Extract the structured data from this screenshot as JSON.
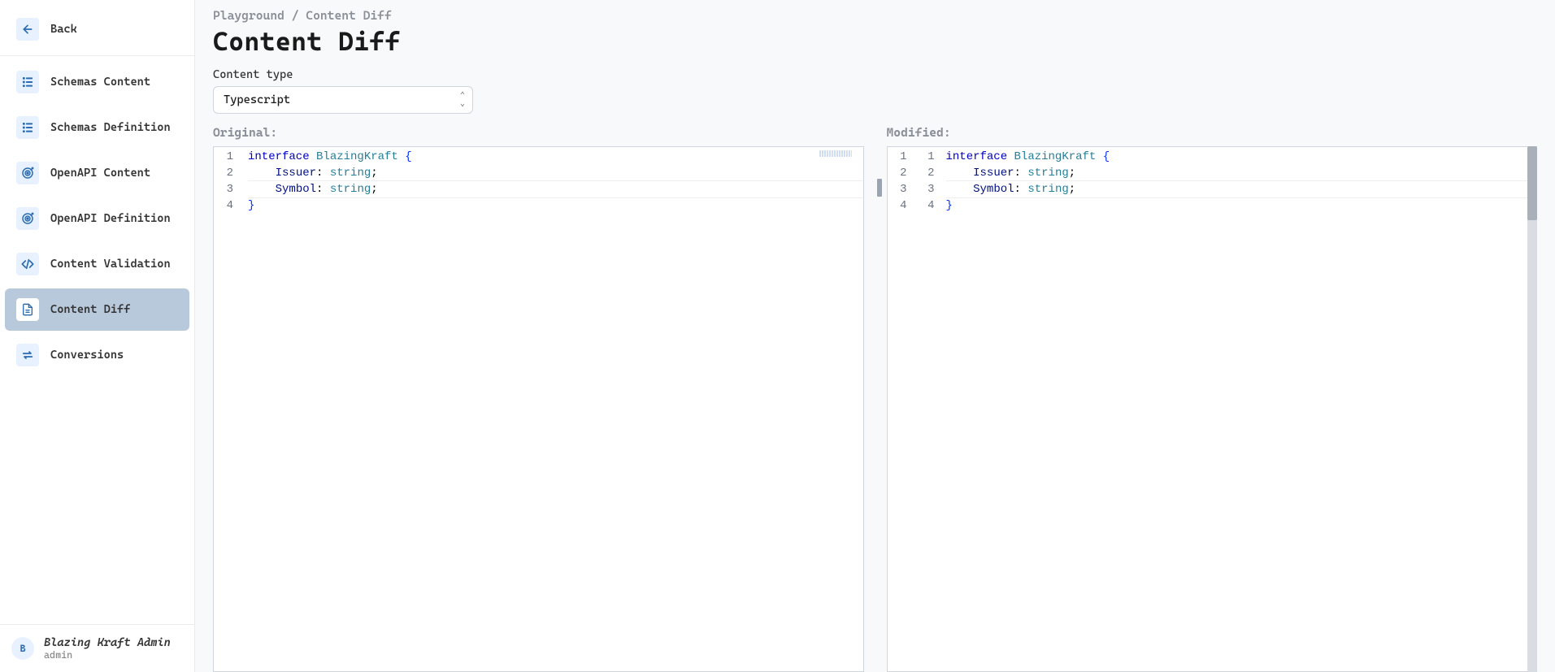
{
  "sidebar": {
    "back_label": "Back",
    "items": [
      {
        "label": "Schemas Content",
        "icon": "nodes-icon",
        "active": false
      },
      {
        "label": "Schemas Definition",
        "icon": "nodes-icon",
        "active": false
      },
      {
        "label": "OpenAPI Content",
        "icon": "target-icon",
        "active": false
      },
      {
        "label": "OpenAPI Definition",
        "icon": "target-icon",
        "active": false
      },
      {
        "label": "Content Validation",
        "icon": "code-icon",
        "active": false
      },
      {
        "label": "Content Diff",
        "icon": "document-icon",
        "active": true
      },
      {
        "label": "Conversions",
        "icon": "swap-icon",
        "active": false
      }
    ]
  },
  "user": {
    "avatar_initial": "B",
    "name": "Blazing Kraft Admin",
    "role": "admin"
  },
  "breadcrumb": {
    "parent": "Playground",
    "sep": "/",
    "current": "Content Diff"
  },
  "page_title": "Content Diff",
  "content_type": {
    "label": "Content type",
    "value": "Typescript"
  },
  "original": {
    "label": "Original:",
    "lines": [
      {
        "n": 1,
        "tokens": [
          {
            "t": "interface ",
            "c": "tok-kw"
          },
          {
            "t": "BlazingKraft ",
            "c": "tok-type"
          },
          {
            "t": "{",
            "c": "tok-brace"
          }
        ]
      },
      {
        "n": 2,
        "tokens": [
          {
            "t": "    ",
            "c": ""
          },
          {
            "t": "Issuer",
            "c": "tok-prop"
          },
          {
            "t": ": ",
            "c": "tok-punc"
          },
          {
            "t": "string",
            "c": "tok-str"
          },
          {
            "t": ";",
            "c": "tok-punc"
          }
        ]
      },
      {
        "n": 3,
        "tokens": [
          {
            "t": "    ",
            "c": ""
          },
          {
            "t": "Symbol",
            "c": "tok-prop"
          },
          {
            "t": ": ",
            "c": "tok-punc"
          },
          {
            "t": "string",
            "c": "tok-str"
          },
          {
            "t": ";",
            "c": "tok-punc"
          }
        ]
      },
      {
        "n": 4,
        "tokens": [
          {
            "t": "}",
            "c": "tok-brace"
          }
        ]
      }
    ]
  },
  "modified": {
    "label": "Modified:",
    "lines": [
      {
        "n": 1,
        "n2": 1,
        "tokens": [
          {
            "t": "interface ",
            "c": "tok-kw"
          },
          {
            "t": "BlazingKraft ",
            "c": "tok-type"
          },
          {
            "t": "{",
            "c": "tok-brace"
          }
        ]
      },
      {
        "n": 2,
        "n2": 2,
        "tokens": [
          {
            "t": "    ",
            "c": ""
          },
          {
            "t": "Issuer",
            "c": "tok-prop"
          },
          {
            "t": ": ",
            "c": "tok-punc"
          },
          {
            "t": "string",
            "c": "tok-str"
          },
          {
            "t": ";",
            "c": "tok-punc"
          }
        ]
      },
      {
        "n": 3,
        "n2": 3,
        "tokens": [
          {
            "t": "    ",
            "c": ""
          },
          {
            "t": "Symbol",
            "c": "tok-prop"
          },
          {
            "t": ": ",
            "c": "tok-punc"
          },
          {
            "t": "string",
            "c": "tok-str"
          },
          {
            "t": ";",
            "c": "tok-punc"
          }
        ]
      },
      {
        "n": 4,
        "n2": 4,
        "tokens": [
          {
            "t": "}",
            "c": "tok-brace"
          }
        ]
      }
    ]
  },
  "icons": {
    "back": "arrow-left-icon"
  },
  "colors": {
    "icon_bg": "#e7f1ff",
    "icon_fg": "#2b6cb0",
    "active_bg": "#b8c9dc"
  }
}
